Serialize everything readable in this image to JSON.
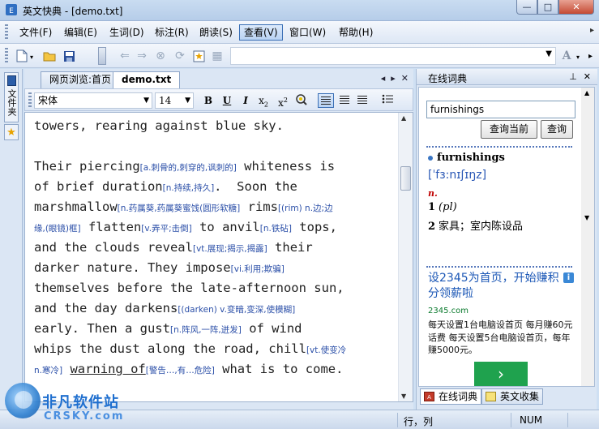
{
  "window": {
    "title": "英文快典 - [demo.txt]",
    "buttons": {
      "minimize": "—",
      "maximize": "□",
      "close": "✕"
    }
  },
  "menu": {
    "items": [
      "文件(F)",
      "编辑(E)",
      "生词(D)",
      "标注(R)",
      "朗读(S)",
      "查看(V)",
      "窗口(W)",
      "帮助(H)"
    ],
    "active_index": 5
  },
  "sidebar": {
    "tab_label": "文件夹"
  },
  "tabs": {
    "items": [
      "网页浏览:首页",
      "demo.txt"
    ],
    "active_index": 1
  },
  "format": {
    "font_name": "宋体",
    "font_size": "14",
    "bold": "B",
    "underline": "U",
    "italic": "I",
    "subscript": "x2",
    "superscript": "x2"
  },
  "editor": {
    "lines": [
      [
        {
          "t": "towers, rearing against blue sky."
        }
      ],
      [
        {
          "t": ""
        }
      ],
      [
        {
          "t": "Their piercing"
        },
        {
          "t": "[a.刺骨的,刺穿的,讽刺的]",
          "ann": true
        },
        {
          "t": " whiteness is"
        }
      ],
      [
        {
          "t": "of brief duration"
        },
        {
          "t": "[n.持续,持久]",
          "ann": true
        },
        {
          "t": ".  Soon the"
        }
      ],
      [
        {
          "t": "marshmallow"
        },
        {
          "t": "[n.药属葵,药属葵蜜饯(圆形软糖]",
          "ann": true
        },
        {
          "t": " rims"
        },
        {
          "t": "[(rim) n.边;边",
          "ann": true
        }
      ],
      [
        {
          "t": "缘,(眼镜)框]",
          "ann": true
        },
        {
          "t": " flatten"
        },
        {
          "t": "[v.弄平;击倒]",
          "ann": true
        },
        {
          "t": " to anvil"
        },
        {
          "t": "[n.铁砧]",
          "ann": true
        },
        {
          "t": " tops,"
        }
      ],
      [
        {
          "t": "and the clouds reveal"
        },
        {
          "t": "[vt.展现;揭示,揭露]",
          "ann": true
        },
        {
          "t": " their"
        }
      ],
      [
        {
          "t": "darker nature. They impose"
        },
        {
          "t": "[vi.利用;欺骗]",
          "ann": true
        }
      ],
      [
        {
          "t": "themselves before the late-afternoon sun,"
        }
      ],
      [
        {
          "t": "and the day darkens"
        },
        {
          "t": "[(darken) v.变暗,变深,使模糊]",
          "ann": true
        }
      ],
      [
        {
          "t": "early. Then a gust"
        },
        {
          "t": "[n.阵风,一阵,迸发]",
          "ann": true
        },
        {
          "t": " of wind"
        }
      ],
      [
        {
          "t": "whips the dust along the road, chill"
        },
        {
          "t": "[vt.使变冷",
          "ann": true
        }
      ],
      [
        {
          "t": "n.寒冷]",
          "ann": true
        },
        {
          "t": " "
        },
        {
          "t": "warning of",
          "ul": true
        },
        {
          "t": "[警告…,有…危险]",
          "ann": true
        },
        {
          "t": " what is to come."
        }
      ]
    ]
  },
  "dictionary": {
    "panel_title": "在线词典",
    "search_value": "furnishings",
    "search_current_button": "查询当前",
    "search_button": "查询",
    "headword": "furnishings",
    "phonetic": "[ˈfɜ:nɪʃɪŋz]",
    "part_of_speech": "n.",
    "definitions": [
      {
        "num": "1",
        "text": "(pl)"
      },
      {
        "num": "2",
        "text": "家具；室内陈设品"
      }
    ],
    "ad": {
      "title": "设2345为首页，开始赚积分领薪啦",
      "info_badge": "i",
      "url": "2345.com",
      "text": "每天设置1台电脑设首页 每月赚60元话费 每天设置5台电脑设首页，每年赚5000元。",
      "arrow": "›"
    },
    "bottom_tabs": [
      "在线词典",
      "英文收集"
    ]
  },
  "status": {
    "row_col": "行，列",
    "num": "NUM"
  },
  "watermark": {
    "cn": "非凡软件站",
    "en": "CRSKY.com"
  }
}
